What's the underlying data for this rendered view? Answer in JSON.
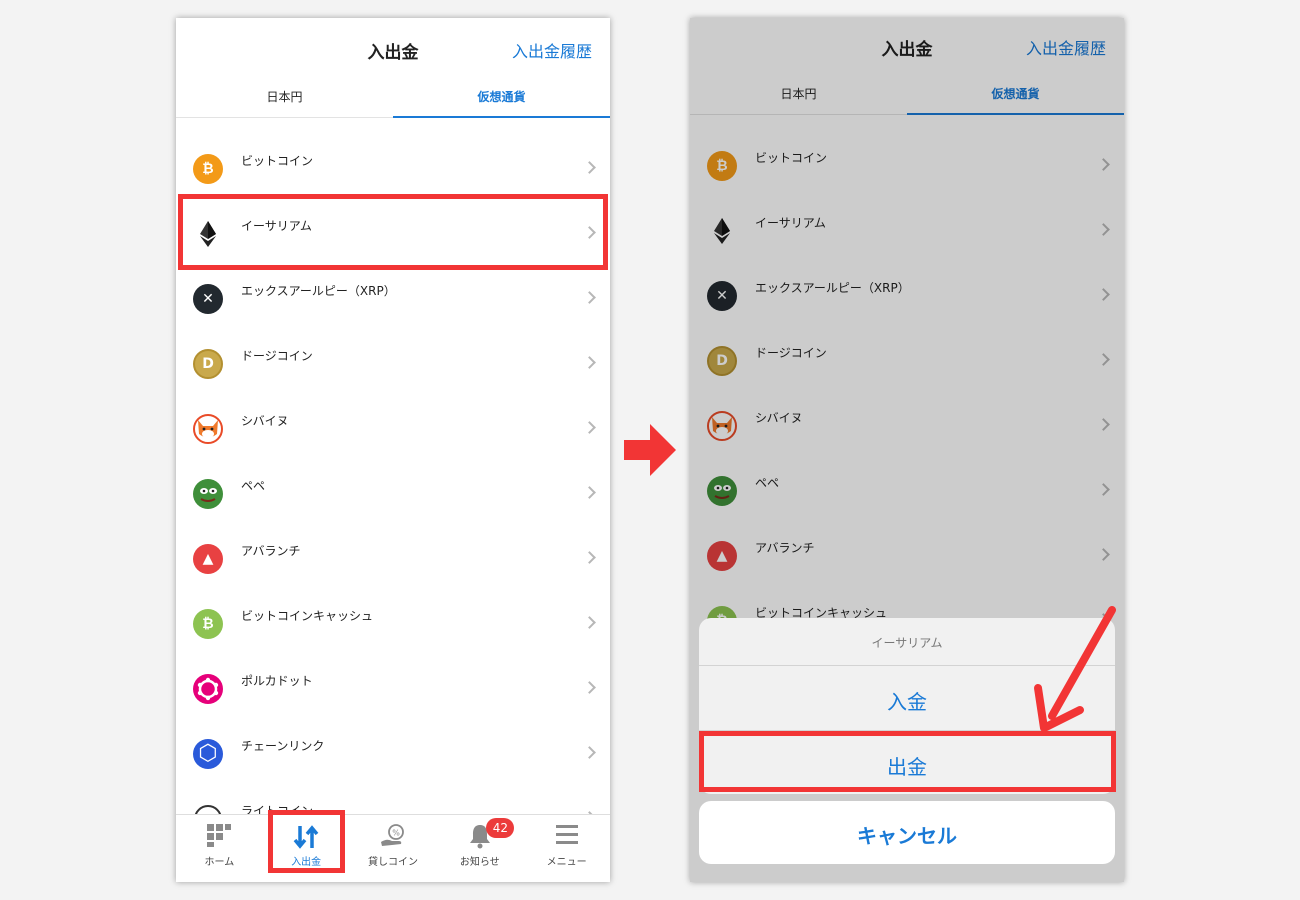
{
  "header": {
    "title": "入出金",
    "history_link": "入出金履歴"
  },
  "tabs": [
    {
      "label": "日本円"
    },
    {
      "label": "仮想通貨"
    }
  ],
  "coins": [
    {
      "label": "ビットコイン",
      "icon": "bitcoin-icon",
      "color": "#f39a18",
      "glyph": "₿"
    },
    {
      "label": "イーサリアム",
      "icon": "ethereum-icon",
      "color": "#ffffff",
      "glyph": ""
    },
    {
      "label": "エックスアールピー（XRP）",
      "icon": "xrp-icon",
      "color": "#22292f",
      "glyph": "✕"
    },
    {
      "label": "ドージコイン",
      "icon": "dogecoin-icon",
      "color": "#c9a94c",
      "glyph": "D"
    },
    {
      "label": "シバイヌ",
      "icon": "shiba-inu-icon",
      "color": "#e7572a",
      "glyph": ""
    },
    {
      "label": "ペペ",
      "icon": "pepe-icon",
      "color": "#3f8f3a",
      "glyph": ""
    },
    {
      "label": "アバランチ",
      "icon": "avalanche-icon",
      "color": "#e84142",
      "glyph": "▲"
    },
    {
      "label": "ビットコインキャッシュ",
      "icon": "bitcoin-cash-icon",
      "color": "#8dc351",
      "glyph": "₿"
    },
    {
      "label": "ポルカドット",
      "icon": "polkadot-icon",
      "color": "#e6007a",
      "glyph": ""
    },
    {
      "label": "チェーンリンク",
      "icon": "chainlink-icon",
      "color": "#2a5ada",
      "glyph": "⬡"
    },
    {
      "label": "ライトコイン",
      "icon": "litecoin-icon",
      "color": "#ffffff",
      "glyph": ""
    }
  ],
  "nav": [
    {
      "label": "ホーム",
      "icon": "home-grid-icon"
    },
    {
      "label": "入出金",
      "icon": "transfer-arrows-icon"
    },
    {
      "label": "貸しコイン",
      "icon": "lending-hand-icon"
    },
    {
      "label": "お知らせ",
      "icon": "bell-icon",
      "badge": "42"
    },
    {
      "label": "メニュー",
      "icon": "hamburger-menu-icon"
    }
  ],
  "sheet": {
    "title": "イーサリアム",
    "deposit": "入金",
    "withdraw": "出金",
    "cancel": "キャンセル"
  },
  "colors": {
    "accent": "#1a7ad6",
    "highlight": "#f23535",
    "badge": "#ec3b3b"
  }
}
